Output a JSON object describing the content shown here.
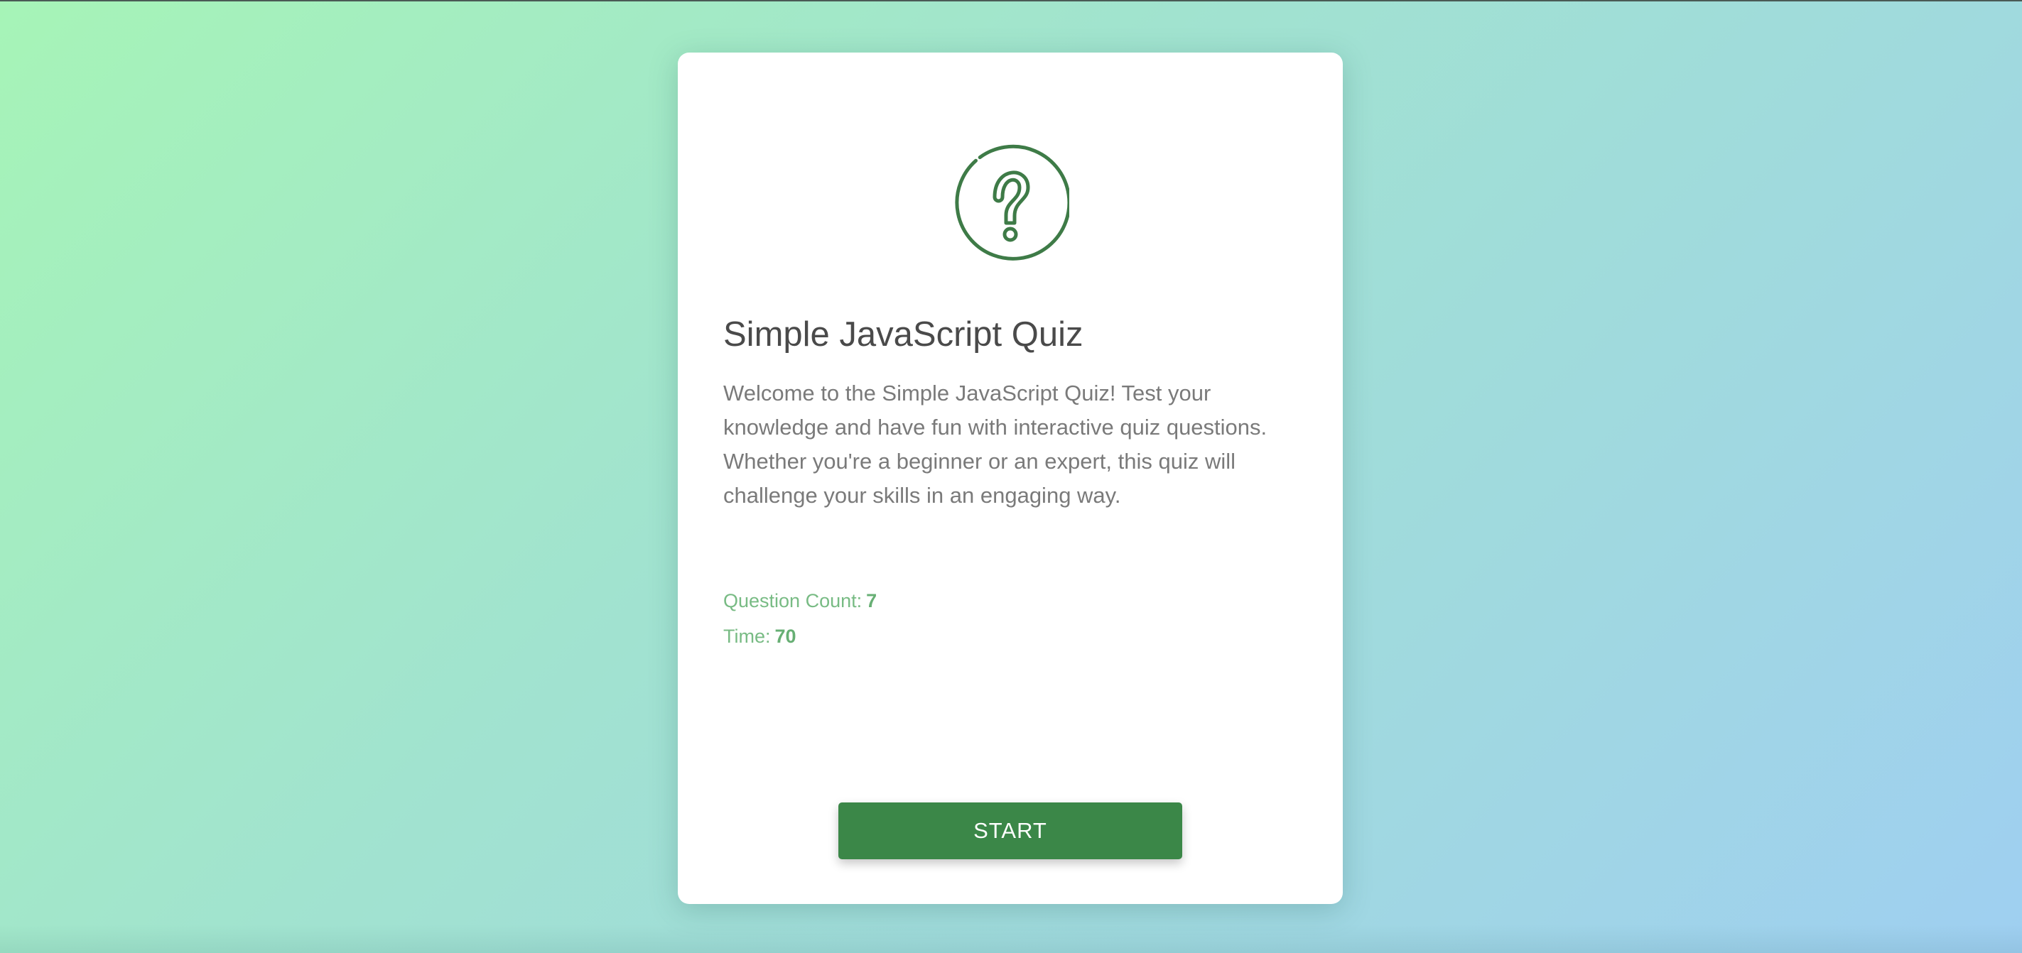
{
  "quiz": {
    "icon": "question-circle-icon",
    "title": "Simple JavaScript Quiz",
    "description": "Welcome to the Simple JavaScript Quiz! Test your knowledge and have fun with interactive quiz questions. Whether you're a beginner or an expert, this quiz will challenge your skills in an engaging way.",
    "question_count_label": "Question Count:",
    "question_count": "7",
    "time_label": "Time:",
    "time": "70",
    "start_label": "START"
  },
  "colors": {
    "accent": "#3b8748",
    "meta_text": "#78bb84",
    "title_text": "#4a4a4a",
    "body_text": "#7a7a7a",
    "background_start": "#a6f4b7",
    "background_end": "#9fcff1"
  }
}
